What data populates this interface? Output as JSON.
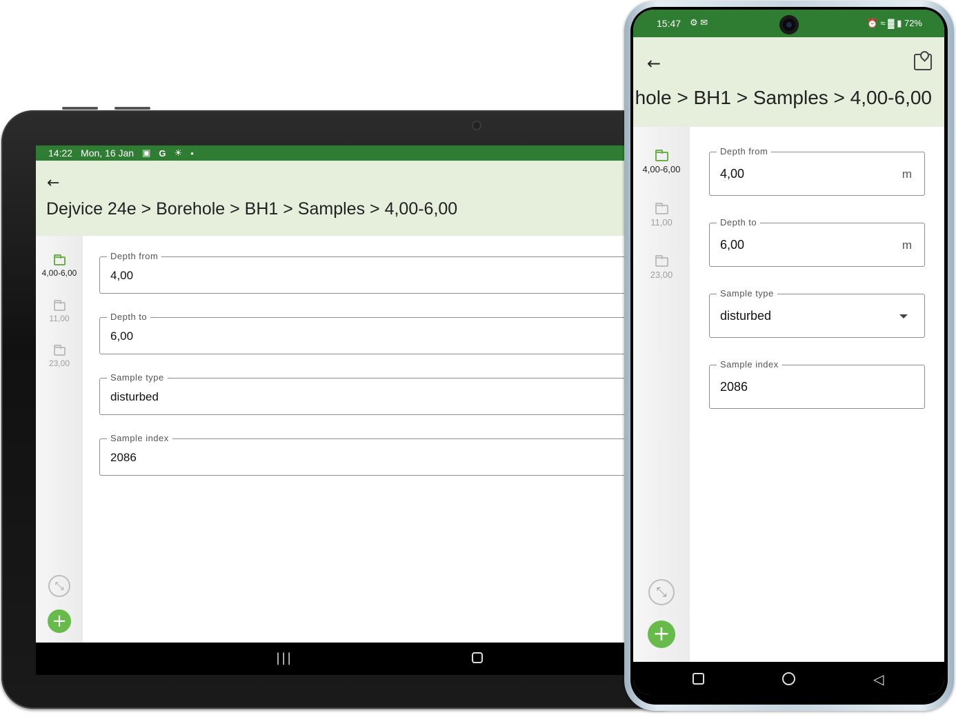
{
  "tablet": {
    "status": {
      "time": "14:22",
      "date": "Mon, 16 Jan",
      "icons": [
        "image-icon",
        "google-icon",
        "brightness-icon",
        "dot-icon"
      ]
    },
    "breadcrumb": "Dejvice 24e > Borehole > BH1 > Samples > 4,00-6,00",
    "sidebar": [
      {
        "label": "4,00-6,00",
        "active": true
      },
      {
        "label": "11,00",
        "active": false
      },
      {
        "label": "23,00",
        "active": false
      }
    ],
    "fields": {
      "depth_from": {
        "label": "Depth from",
        "value": "4,00"
      },
      "depth_to": {
        "label": "Depth to",
        "value": "6,00"
      },
      "sample_type": {
        "label": "Sample type",
        "value": "disturbed"
      },
      "sample_index": {
        "label": "Sample index",
        "value": "2086"
      }
    }
  },
  "phone": {
    "status": {
      "time": "15:47",
      "battery": "72%"
    },
    "breadcrumb": "hole > BH1 > Samples > 4,00-6,00",
    "sidebar": [
      {
        "label": "4,00-6,00",
        "active": true
      },
      {
        "label": "11,00",
        "active": false
      },
      {
        "label": "23,00",
        "active": false
      }
    ],
    "fields": {
      "depth_from": {
        "label": "Depth from",
        "value": "4,00",
        "unit": "m"
      },
      "depth_to": {
        "label": "Depth to",
        "value": "6,00",
        "unit": "m"
      },
      "sample_type": {
        "label": "Sample type",
        "value": "disturbed"
      },
      "sample_index": {
        "label": "Sample index",
        "value": "2086"
      }
    }
  },
  "colors": {
    "status_bar": "#2f7d32",
    "app_bar": "#e6efdc",
    "accent": "#66bb4a"
  }
}
